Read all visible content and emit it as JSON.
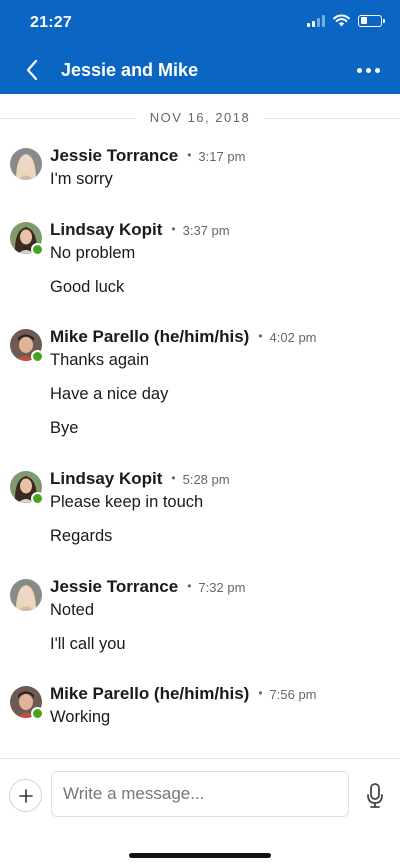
{
  "status_bar": {
    "time": "21:27"
  },
  "header": {
    "title": "Jessie and Mike"
  },
  "date_divider": "NOV 16, 2018",
  "colors": {
    "header_bg": "#0a66c2",
    "online_indicator": "#44a51c"
  },
  "icons": {
    "back": "chevron-left-icon",
    "more": "more-horizontal-icon",
    "add": "plus-icon",
    "mic": "microphone-icon",
    "signal": "cellular-signal-icon",
    "wifi": "wifi-icon",
    "battery": "battery-icon"
  },
  "messages": [
    {
      "sender": "Jessie Torrance",
      "time": "3:17 pm",
      "online": false,
      "lines": [
        "I'm sorry"
      ]
    },
    {
      "sender": "Lindsay Kopit",
      "time": "3:37 pm",
      "online": true,
      "lines": [
        "No problem",
        "Good luck"
      ]
    },
    {
      "sender": "Mike Parello (he/him/his)",
      "time": "4:02 pm",
      "online": true,
      "lines": [
        "Thanks again",
        "Have a nice day",
        "Bye"
      ]
    },
    {
      "sender": "Lindsay Kopit",
      "time": "5:28 pm",
      "online": true,
      "lines": [
        "Please keep in touch",
        "Regards"
      ]
    },
    {
      "sender": "Jessie Torrance",
      "time": "7:32 pm",
      "online": false,
      "lines": [
        "Noted",
        "I'll call you"
      ]
    },
    {
      "sender": "Mike Parello (he/him/his)",
      "time": "7:56 pm",
      "online": true,
      "lines": [
        "Working"
      ]
    }
  ],
  "composer": {
    "placeholder": "Write a message..."
  }
}
